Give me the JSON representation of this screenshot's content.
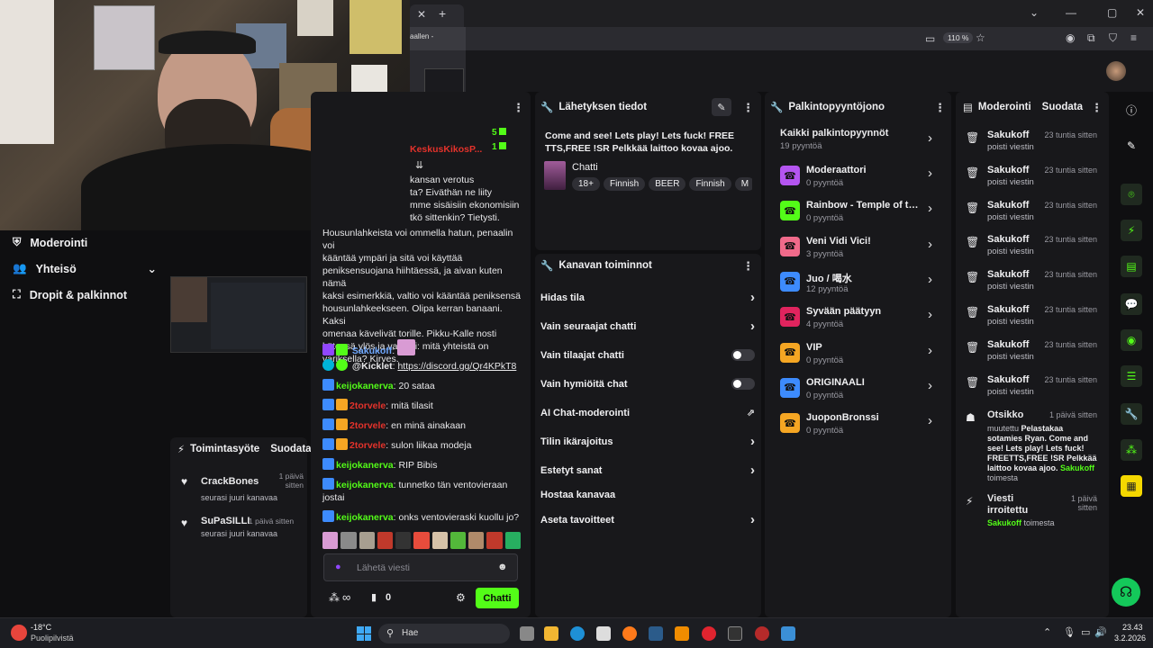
{
  "browser": {
    "tab_fragment": "aallen -",
    "zoom": "110 %"
  },
  "nav": {
    "moderation": "Moderointi",
    "community": "Yhteisö",
    "drops": "Dropit & palkinnot"
  },
  "activity": {
    "title": "Toimintasyöte",
    "filter": "Suodata",
    "items": [
      {
        "user": "CrackBones",
        "time": "1 päivä sitten",
        "action": "seurasi juuri kanavaa"
      },
      {
        "user": "SuPaSILLI",
        "time": "1 päivä sitten",
        "action": "seurasi juuri kanavaa"
      }
    ]
  },
  "chat": {
    "counts": {
      "a": "5",
      "b": "1"
    },
    "pinned_user": "KeskusKikosP...",
    "message_lines": [
      "kansan verotus",
      "ta? Eiväthän ne liity",
      "mme sisäisiin ekonomisiin",
      "tkö sittenkin? Tietysti.",
      "Housunlahkeista voi ommella hatun, penaalin voi",
      "kääntää ympäri ja sitä voi käyttää",
      "peniksensuojana hiihtäessä, ja aivan kuten nämä",
      "kaksi esimerkkiä, valtio voi kääntää peniksensä",
      "housunlahkeekseen. Olipa kerran banaani. Kaksi",
      "omenaa kävelivät torille. Pikku-Kalle nosti",
      "kätensä ylös ja vastasi: mitä yhteistä on",
      "variksella? Kirves."
    ],
    "messages": [
      {
        "user": "Sakukoff",
        "text": "",
        "color": "blue"
      },
      {
        "user": "@Kicklet",
        "text": "https://discord.gg/Qr4KPkT8",
        "color": "white"
      },
      {
        "user": "keijokanerva",
        "text": "20 sataa",
        "color": "green"
      },
      {
        "user": "2torvele",
        "text": "mitä tilasit",
        "color": "red"
      },
      {
        "user": "2torvele",
        "text": "en minä ainakaan",
        "color": "red"
      },
      {
        "user": "2torvele",
        "text": "sulon liikaa modeja",
        "color": "red"
      },
      {
        "user": "keijokanerva",
        "text": "RIP Bibis",
        "color": "green"
      },
      {
        "user": "keijokanerva",
        "text": "tunnetko tän ventovieraan jostai",
        "color": "green"
      },
      {
        "user": "keijokanerva",
        "text": "onks ventovieraski kuollu jo?",
        "color": "green"
      }
    ],
    "input_placeholder": "Lähetä viesti",
    "points": "0",
    "send": "Chatti"
  },
  "stream_info": {
    "title": "Lähetyksen tiedot",
    "stream_title": "Come and see! Lets play! Lets fuck! FREE TTS,FREE !SR Pelkkää laittoo kovaa ajoo.",
    "category": "Chatti",
    "tags": [
      "18+",
      "Finnish",
      "BEER",
      "Finnish",
      "M"
    ]
  },
  "channel_actions": {
    "title": "Kanavan toiminnot",
    "items": [
      {
        "label": "Hidas tila",
        "control": "chevron"
      },
      {
        "label": "Vain seuraajat chatti",
        "control": "chevron"
      },
      {
        "label": "Vain tilaajat chatti",
        "control": "toggle"
      },
      {
        "label": "Vain hymiöitä chat",
        "control": "toggle"
      },
      {
        "label": "AI Chat-moderointi",
        "control": "external"
      },
      {
        "label": "Tilin ikärajoitus",
        "control": "chevron"
      },
      {
        "label": "Estetyt sanat",
        "control": "chevron"
      },
      {
        "label": "Hostaa kanavaa",
        "control": "none"
      },
      {
        "label": "Aseta tavoitteet",
        "control": "chevron"
      }
    ]
  },
  "rewards": {
    "title": "Palkintopyyntöjono",
    "all": {
      "label": "Kaikki palkintopyynnöt",
      "count": "19 pyyntöä"
    },
    "items": [
      {
        "name": "Moderaattori",
        "count": "0 pyyntöä",
        "color": "#b455f0"
      },
      {
        "name": "Rainbow - Temple of th...",
        "count": "0 pyyntöä",
        "color": "#53fc18"
      },
      {
        "name": "Veni Vidi Vici!",
        "count": "3 pyyntöä",
        "color": "#f06a8a"
      },
      {
        "name": "Juo / 喝水",
        "count": "12 pyyntöä",
        "color": "#3d8bfd"
      },
      {
        "name": "Syvään päätyyn",
        "count": "4 pyyntöä",
        "color": "#e0245e"
      },
      {
        "name": "VIP",
        "count": "0 pyyntöä",
        "color": "#f5a623"
      },
      {
        "name": "ORIGINAALI",
        "count": "0 pyyntöä",
        "color": "#3d8bfd"
      },
      {
        "name": "JuoponBronssi",
        "count": "0 pyyntöä",
        "color": "#f5a623"
      }
    ]
  },
  "modlog": {
    "title": "Moderointi",
    "filter": "Suodata",
    "items": [
      {
        "who": "Sakukoff",
        "when": "23 tuntia sitten",
        "what": "poisti viestin"
      },
      {
        "who": "Sakukoff",
        "when": "23 tuntia sitten",
        "what": "poisti viestin"
      },
      {
        "who": "Sakukoff",
        "when": "23 tuntia sitten",
        "what": "poisti viestin"
      },
      {
        "who": "Sakukoff",
        "when": "23 tuntia sitten",
        "what": "poisti viestin"
      },
      {
        "who": "Sakukoff",
        "when": "23 tuntia sitten",
        "what": "poisti viestin"
      },
      {
        "who": "Sakukoff",
        "when": "23 tuntia sitten",
        "what": "poisti viestin"
      },
      {
        "who": "Sakukoff",
        "when": "23 tuntia sitten",
        "what": "poisti viestin"
      },
      {
        "who": "Sakukoff",
        "when": "23 tuntia sitten",
        "what": "poisti viestin"
      }
    ],
    "title_change": {
      "label": "Otsikko",
      "when": "1 päivä sitten",
      "prefix": "muutettu",
      "text": "Pelastakaa sotamies Ryan. Come and see! Lets play! Lets fuck! FREETTS,FREE !SR Pelkkää laittoo kovaa ajoo.",
      "by": "Sakukoff",
      "suffix": "toimesta"
    },
    "unpinned": {
      "label": "Viesti irroitettu",
      "when": "1 päivä sitten",
      "by": "Sakukoff",
      "suffix": "toimesta"
    }
  },
  "taskbar": {
    "weather_temp": "-18°C",
    "weather_desc": "Puolipilvistä",
    "search": "Hae",
    "time": "23.43",
    "date": "3.2.2026"
  }
}
